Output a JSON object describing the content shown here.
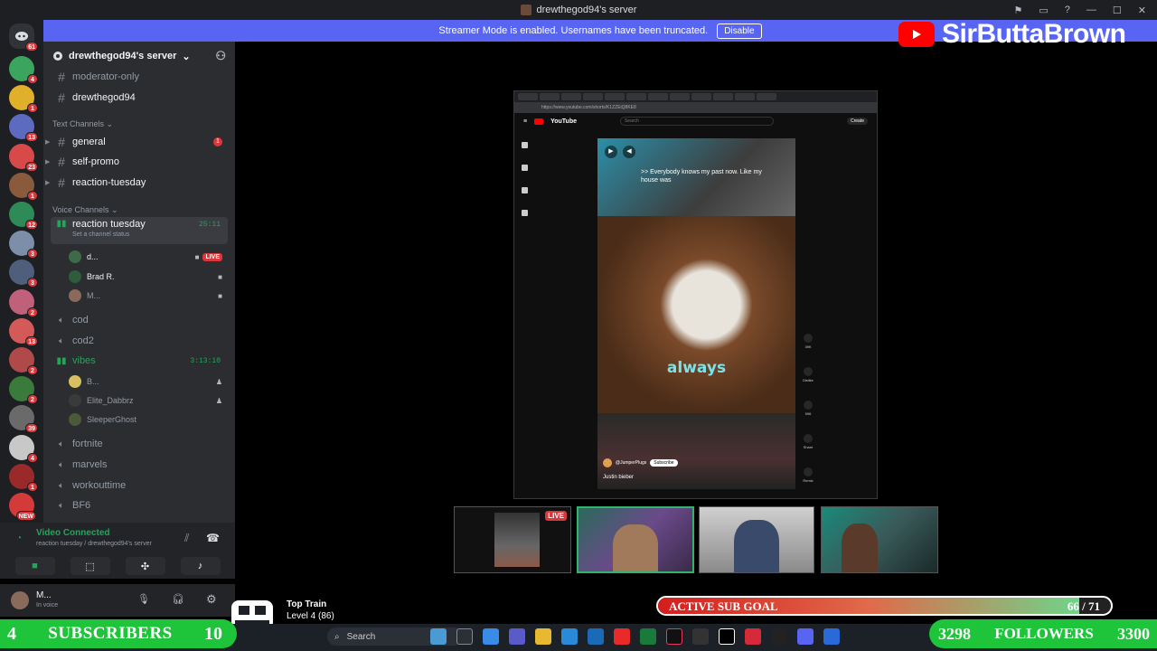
{
  "window": {
    "title": "drewthegod94's server",
    "controls": [
      "⚑",
      "▭",
      "?",
      "—",
      "☐",
      "✕"
    ]
  },
  "streamer_banner": {
    "text": "Streamer Mode is enabled. Usernames have been truncated.",
    "button": "Disable"
  },
  "guild_bar": {
    "home_badge": "61",
    "guilds": [
      {
        "color": "#3ba55d",
        "badge": "4"
      },
      {
        "color": "#e0b02a",
        "badge": "1"
      },
      {
        "color": "#5c6bc0",
        "badge": "13"
      },
      {
        "color": "#d84a4a",
        "badge": "23"
      },
      {
        "color": "#8a5a3c",
        "badge": "1"
      },
      {
        "color": "#2e8b57",
        "badge": "12"
      },
      {
        "color": "#7b8fa8",
        "badge": "3"
      },
      {
        "color": "#4d5f7a",
        "badge": "3"
      },
      {
        "color": "#c0607a",
        "badge": "2"
      },
      {
        "color": "#d45a5a",
        "badge": "13"
      },
      {
        "color": "#b04a4a",
        "badge": "2"
      },
      {
        "color": "#3a7a3a",
        "badge": "2"
      },
      {
        "color": "#6a6a6a",
        "badge": "39"
      },
      {
        "color": "#c8c8c8",
        "badge": "4"
      },
      {
        "color": "#9a2a2a",
        "badge": "1"
      },
      {
        "color": "#d43a3a",
        "badge": "NEW"
      }
    ]
  },
  "sidebar": {
    "server_name": "drewthegod94's server",
    "top_channels": [
      "moderator-only",
      "drewthegod94"
    ],
    "text_category": "Text Channels",
    "text_channels": [
      {
        "name": "general",
        "unread": "1"
      },
      {
        "name": "self-promo",
        "unread": ""
      },
      {
        "name": "reaction-tuesday",
        "unread": ""
      }
    ],
    "voice_category": "Voice Channels",
    "active_voice": {
      "name": "reaction tuesday",
      "timer": "25:11",
      "status": "Set a channel status",
      "users": [
        {
          "name": "d...",
          "live": "LIVE"
        },
        {
          "name": "Brad R.",
          "live": ""
        },
        {
          "name": "M...",
          "live": ""
        }
      ]
    },
    "voice_channels_a": [
      "cod",
      "cod2"
    ],
    "vibes": {
      "name": "vibes",
      "timer": "3:13:10",
      "users": [
        "B...",
        "Elite_Dabbrz",
        "SleeperGhost"
      ]
    },
    "voice_channels_b": [
      "fortnite",
      "marvels",
      "workouttime",
      "BF6"
    ]
  },
  "voice_panel": {
    "status": "Video Connected",
    "channel": "reaction tuesday / drewthegod94's server"
  },
  "user_panel": {
    "name": "M...",
    "status": "In voice"
  },
  "stream": {
    "yt_brand": "YouTube",
    "search_placeholder": "Search",
    "url": "https://www.youtube.com/shorts/K1ZZEiQ8KE8",
    "caption_top": ">> Everybody knows my past now. Like my house was",
    "caption_big": "always",
    "channel": "@JumperPlugs",
    "subscribe": "Subscribe",
    "video_title": "Justin bieber",
    "actions": [
      "39K",
      "Dislike",
      "596",
      "Share",
      "Remix"
    ],
    "create": "Create"
  },
  "participants_live": "LIVE",
  "overlay": {
    "brand": "SirButtaBrown",
    "sub_goal_label": "ACTIVE SUB GOAL",
    "sub_goal_current": "66",
    "sub_goal_target": "71",
    "sub_goal_fraction": 0.93,
    "subscribers_left": "4",
    "subscribers_label": "SUBSCRIBERS",
    "subscribers_right": "10",
    "followers_left": "3298",
    "followers_label": "FOLLOWERS",
    "followers_right": "3300",
    "train_name": "Top Train",
    "train_level": "Level 4 (86)"
  },
  "taskbar": {
    "search": "Search"
  }
}
